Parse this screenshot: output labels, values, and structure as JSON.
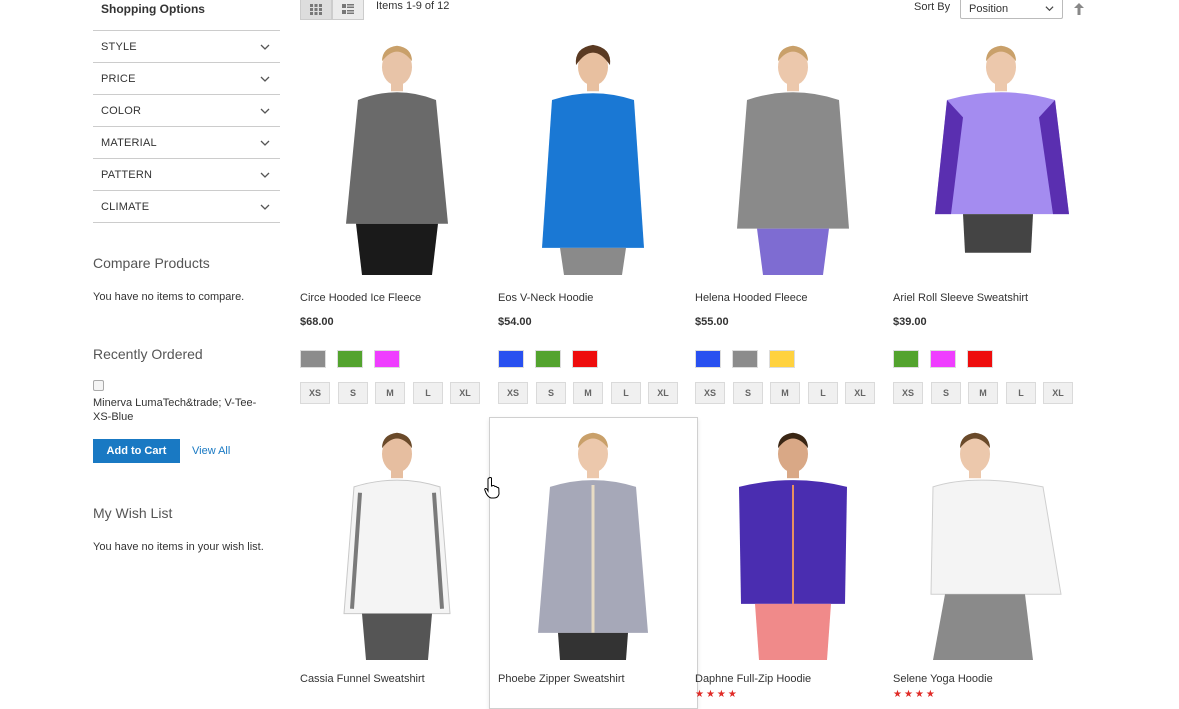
{
  "sidebar": {
    "title": "Shopping Options",
    "filters": [
      "STYLE",
      "PRICE",
      "COLOR",
      "MATERIAL",
      "PATTERN",
      "CLIMATE"
    ],
    "compare_title": "Compare Products",
    "compare_text": "You have no items to compare.",
    "recent_title": "Recently Ordered",
    "recent_item": "Minerva LumaTech&trade; V-Tee-XS-Blue",
    "add_to_cart": "Add to Cart",
    "view_all": "View All",
    "wish_title": "My Wish List",
    "wish_text": "You have no items in your wish list."
  },
  "toolbar": {
    "items_count": "Items 1-9 of 12",
    "sort_label": "Sort By",
    "sort_value": "Position"
  },
  "products": [
    {
      "name": "Circe Hooded Ice Fleece",
      "price": "$68.00",
      "swatches": [
        "#8c8c8c",
        "#53a32e",
        "#ef3dff"
      ],
      "sizes": [
        "XS",
        "S",
        "M",
        "L",
        "XL"
      ],
      "top_color": "#6a6a6a",
      "bottom_color": "#1a1a1a"
    },
    {
      "name": "Eos V-Neck Hoodie",
      "price": "$54.00",
      "swatches": [
        "#2850f0",
        "#53a32e",
        "#ee0d0d"
      ],
      "sizes": [
        "XS",
        "S",
        "M",
        "L",
        "XL"
      ],
      "top_color": "#1a78d4",
      "bottom_color": "#8a8a8a"
    },
    {
      "name": "Helena Hooded Fleece",
      "price": "$55.00",
      "swatches": [
        "#2850f0",
        "#8c8c8c",
        "#ffd23f"
      ],
      "sizes": [
        "XS",
        "S",
        "M",
        "L",
        "XL"
      ],
      "top_color": "#8a8a8a",
      "bottom_color": "#7e6cd2"
    },
    {
      "name": "Ariel Roll Sleeve Sweatshirt",
      "price": "$39.00",
      "swatches": [
        "#53a32e",
        "#ef3dff",
        "#ee0d0d"
      ],
      "sizes": [
        "XS",
        "S",
        "M",
        "L",
        "XL"
      ],
      "top_color": "#a48cf0",
      "bottom_color": "#444444"
    },
    {
      "name": "Cassia Funnel Sweatshirt",
      "top_color": "#f4f4f4",
      "bottom_color": "#555555"
    },
    {
      "name": "Phoebe Zipper Sweatshirt",
      "top_color": "#a6a8b8",
      "bottom_color": "#333333"
    },
    {
      "name": "Daphne Full-Zip Hoodie",
      "top_color": "#4a2db0",
      "bottom_color": "#f08a8a"
    },
    {
      "name": "Selene Yoga Hoodie",
      "top_color": "#f4f4f4",
      "bottom_color": "#8a8a8a"
    }
  ],
  "icons": {
    "grid": "grid-icon",
    "list": "list-icon",
    "chevron": "chevron-down-icon",
    "sort_direction": "arrow-up-icon",
    "cursor": "hand-pointer-icon"
  }
}
